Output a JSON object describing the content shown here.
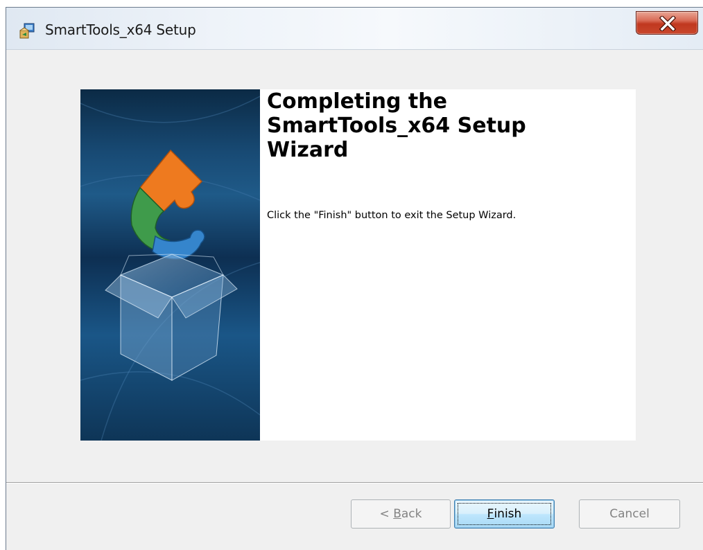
{
  "window": {
    "title": "SmartTools_x64 Setup",
    "app_icon": "installer-icon",
    "close_icon": "close-x-icon",
    "close_color": "#c9462c"
  },
  "content": {
    "heading": "Completing the\nSmartTools_x64 Setup\nWizard",
    "message": "Click the \"Finish\" button to exit the Setup Wizard.",
    "banner_image": "installer-box-puzzle-graphic"
  },
  "buttons": {
    "back": {
      "prefix": "< ",
      "mnemonic": "B",
      "rest": "ack",
      "enabled": false
    },
    "finish": {
      "mnemonic": "F",
      "rest": "inish",
      "enabled": true,
      "default": true
    },
    "cancel": {
      "label": "Cancel",
      "enabled": false
    }
  },
  "colors": {
    "banner_dark": "#0b2a45",
    "banner_mid": "#1f5a88",
    "puzzle_orange": "#e8721c",
    "puzzle_green": "#3c9a4a",
    "puzzle_blue": "#2f7fc4",
    "finish_button": "#bee6fd"
  }
}
